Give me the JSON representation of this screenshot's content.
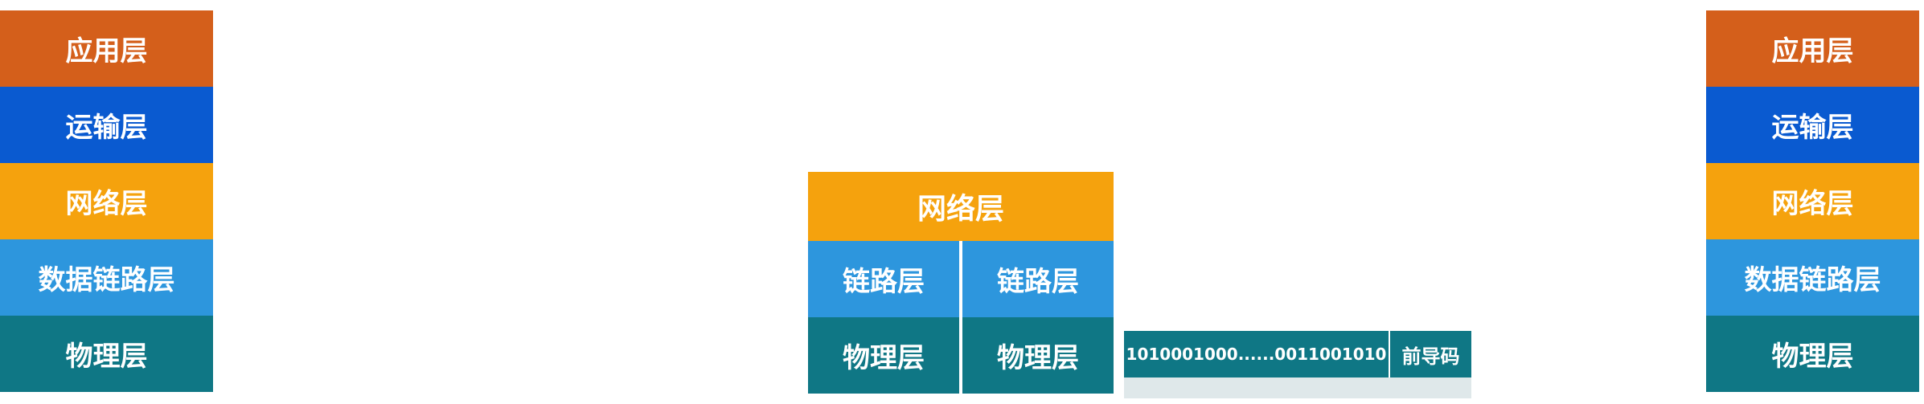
{
  "left_stack": {
    "layers": [
      "应用层",
      "运输层",
      "网络层",
      "数据链路层",
      "物理层"
    ]
  },
  "router": {
    "network": "网络层",
    "link_left": "链路层",
    "link_right": "链路层",
    "phys_left": "物理层",
    "phys_right": "物理层"
  },
  "bitstream": {
    "data": "1010001000......0011001010",
    "preamble": "前导码"
  },
  "right_stack": {
    "layers": [
      "应用层",
      "运输层",
      "网络层",
      "数据链路层",
      "物理层"
    ]
  },
  "colors": {
    "application": "#d45f1b",
    "transport": "#0a5ad0",
    "network": "#f5a20d",
    "link": "#2d96dd",
    "physical": "#0f7785"
  }
}
